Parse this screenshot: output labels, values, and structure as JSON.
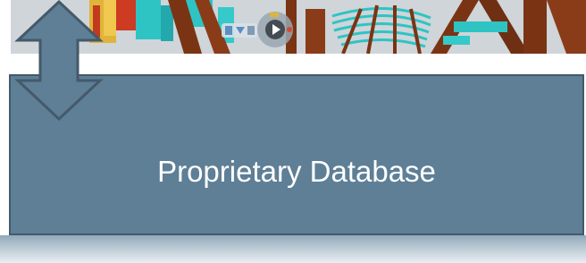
{
  "database": {
    "label": "Proprietary Database"
  },
  "colors": {
    "box_fill": "#5e7f96",
    "box_border": "#44596a",
    "arrow_fill": "#5e7f96",
    "arrow_stroke": "#44596a",
    "label_text": "#ffffff",
    "model_cyan": "#2ec4c4",
    "model_brown": "#7a3414"
  },
  "icons": {
    "arrow": "double-headed-vertical-arrow",
    "viewer_controls": "3d-navigation-wheel"
  }
}
